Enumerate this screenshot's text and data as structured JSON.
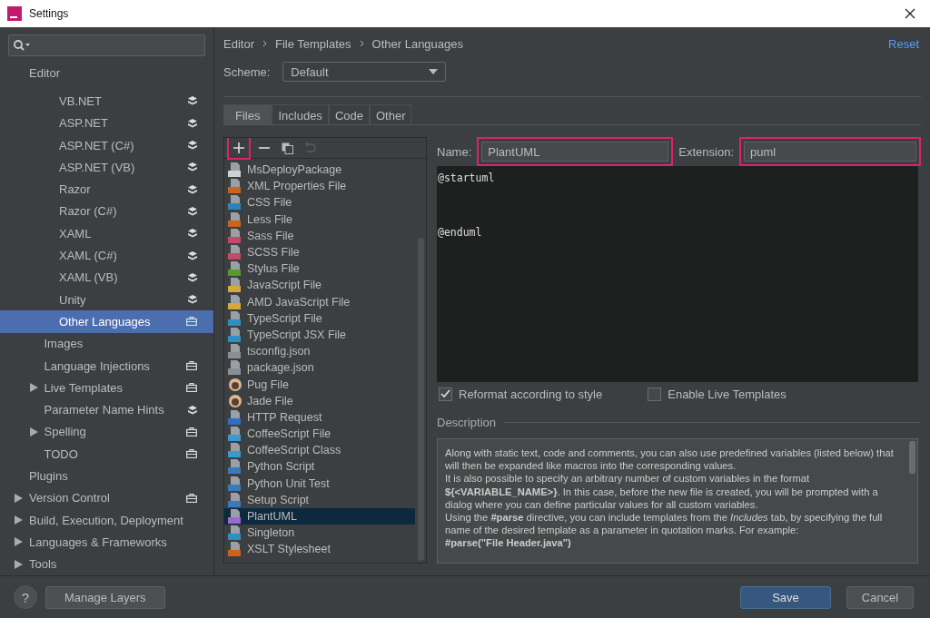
{
  "window": {
    "title": "Settings"
  },
  "tree": [
    {
      "label": "Editor",
      "selected": false,
      "children": [
        {
          "children": [
            {
              "label": "VB.NET",
              "kind": "ide",
              "selected": false
            },
            {
              "label": "ASP.NET",
              "kind": "ide",
              "selected": false
            },
            {
              "label": "ASP.NET (C#)",
              "kind": "ide",
              "selected": false
            },
            {
              "label": "ASP.NET (VB)",
              "kind": "ide",
              "selected": false
            },
            {
              "label": "Razor",
              "kind": "ide",
              "selected": false
            },
            {
              "label": "Razor (C#)",
              "kind": "ide",
              "selected": false
            },
            {
              "label": "XAML",
              "kind": "ide",
              "selected": false
            },
            {
              "label": "XAML (C#)",
              "kind": "ide",
              "selected": false
            },
            {
              "label": "XAML (VB)",
              "kind": "ide",
              "selected": false
            },
            {
              "label": "Unity",
              "kind": "ide",
              "selected": false
            },
            {
              "label": "Other Languages",
              "kind": "project",
              "selected": true
            }
          ]
        },
        {
          "label": "Images",
          "selected": false
        },
        {
          "label": "Language Injections",
          "kind": "project",
          "selected": false
        },
        {
          "label": "Live Templates",
          "kind": "project",
          "expanded": false,
          "selected": false
        },
        {
          "label": "Parameter Name Hints",
          "kind": "ide",
          "selected": false
        },
        {
          "label": "Spelling",
          "kind": "project",
          "expanded": false,
          "selected": false
        },
        {
          "label": "TODO",
          "kind": "project",
          "selected": false
        }
      ]
    },
    {
      "label": "Plugins",
      "selected": false
    },
    {
      "label": "Version Control",
      "kind": "project",
      "expanded": false,
      "selected": false
    },
    {
      "label": "Build, Execution, Deployment",
      "expanded": false,
      "selected": false
    },
    {
      "label": "Languages & Frameworks",
      "expanded": false,
      "selected": false
    },
    {
      "label": "Tools",
      "expanded": false,
      "selected": false
    }
  ],
  "breadcrumb": [
    "Editor",
    "File Templates",
    "Other Languages"
  ],
  "reset": "Reset",
  "scheme": {
    "label": "Scheme:",
    "value": "Default"
  },
  "tabs": [
    {
      "label": "Files",
      "selected": true
    },
    {
      "label": "Includes",
      "selected": false
    },
    {
      "label": "Code",
      "selected": false
    },
    {
      "label": "Other",
      "selected": false
    }
  ],
  "toolbar": [
    {
      "kind": "add",
      "disabled": false,
      "highlighted": true
    },
    {
      "kind": "remove",
      "disabled": false,
      "highlighted": false
    },
    {
      "kind": "copy",
      "disabled": false,
      "highlighted": false
    },
    {
      "kind": "reset",
      "disabled": true,
      "highlighted": false
    }
  ],
  "files": [
    {
      "label": "MsDeployPackage",
      "kind": "package",
      "selected": false
    },
    {
      "label": "XML Properties File",
      "kind": "xml",
      "selected": false
    },
    {
      "label": "CSS File",
      "kind": "css",
      "selected": false
    },
    {
      "label": "Less File",
      "kind": "less",
      "selected": false
    },
    {
      "label": "Sass File",
      "kind": "sass",
      "selected": false
    },
    {
      "label": "SCSS File",
      "kind": "sass",
      "selected": false
    },
    {
      "label": "Stylus File",
      "kind": "stylus",
      "selected": false
    },
    {
      "label": "JavaScript File",
      "kind": "js",
      "selected": false
    },
    {
      "label": "AMD JavaScript File",
      "kind": "js",
      "selected": false
    },
    {
      "label": "TypeScript File",
      "kind": "ts",
      "selected": false
    },
    {
      "label": "TypeScript JSX File",
      "kind": "ts",
      "selected": false
    },
    {
      "label": "tsconfig.json",
      "kind": "json",
      "selected": false
    },
    {
      "label": "package.json",
      "kind": "json",
      "selected": false
    },
    {
      "label": "Pug File",
      "kind": "pug",
      "selected": false
    },
    {
      "label": "Jade File",
      "kind": "pug",
      "selected": false
    },
    {
      "label": "HTTP Request",
      "kind": "api",
      "selected": false
    },
    {
      "label": "CoffeeScript File",
      "kind": "coffee",
      "selected": false
    },
    {
      "label": "CoffeeScript Class",
      "kind": "coffee",
      "selected": false
    },
    {
      "label": "Python Script",
      "kind": "python",
      "selected": false
    },
    {
      "label": "Python Unit Test",
      "kind": "python",
      "selected": false
    },
    {
      "label": "Setup Script",
      "kind": "python",
      "selected": false
    },
    {
      "label": "PlantUML",
      "kind": "plantuml",
      "selected": true
    },
    {
      "label": "Singleton",
      "kind": "ts",
      "selected": false
    },
    {
      "label": "XSLT Stylesheet",
      "kind": "xml",
      "selected": false
    }
  ],
  "name_field": {
    "label": "Name:",
    "value": "PlantUML",
    "highlighted": true
  },
  "extension_field": {
    "label": "Extension:",
    "value": "puml",
    "highlighted": true
  },
  "code_lines": [
    "@startuml",
    "@enduml"
  ],
  "options": [
    {
      "label": "Reformat according to style",
      "checked": true
    },
    {
      "label": "Enable Live Templates",
      "checked": false
    }
  ],
  "description": {
    "title": "Description",
    "paragraphs": [
      "Along with static text, code and comments, you can also use predefined variables (listed below) that will then be expanded like macros into the corresponding values.",
      "It is also possible to specify an arbitrary number of custom variables in the format **${<VARIABLE_NAME>}**. In this case, before the new file is created, you will be prompted with a dialog where you can define particular values for all custom variables.",
      "Using the **#parse** directive, you can include templates from the *Includes* tab, by specifying the full name of the desired template as a parameter in quotation marks. For example:",
      "**#parse(\"File Header.java\")**"
    ]
  },
  "buttons": {
    "help": "?",
    "manage": "Manage Layers",
    "save": "Save",
    "cancel": "Cancel"
  }
}
